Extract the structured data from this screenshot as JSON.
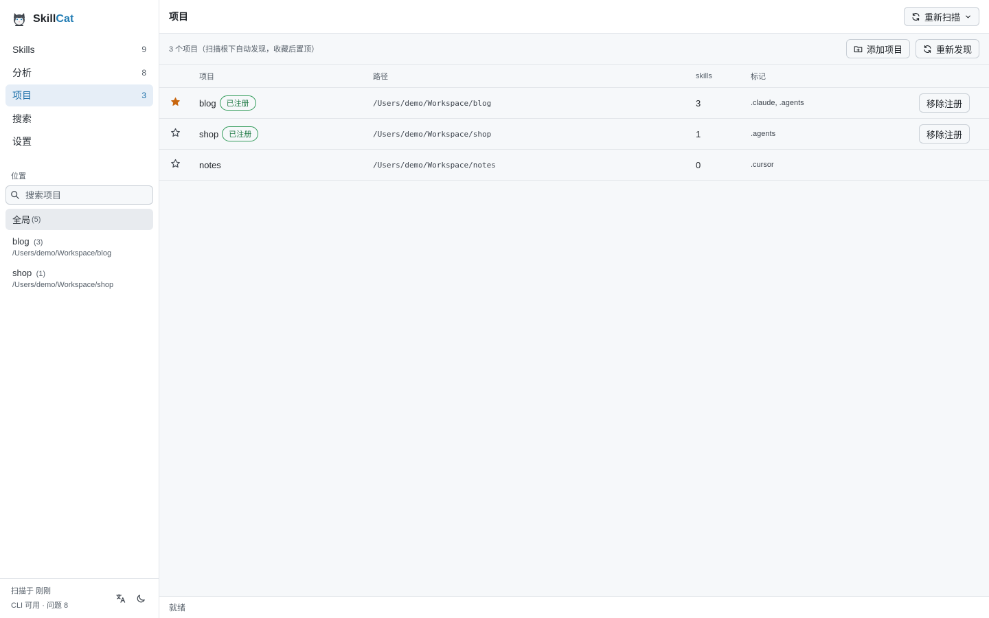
{
  "app": {
    "brand_part1": "Skill",
    "brand_part2": "Cat"
  },
  "nav": [
    {
      "label": "Skills",
      "count": "9"
    },
    {
      "label": "分析",
      "count": "8"
    },
    {
      "label": "项目",
      "count": "3"
    },
    {
      "label": "搜索",
      "count": ""
    },
    {
      "label": "设置",
      "count": ""
    }
  ],
  "locations": {
    "section_label": "位置",
    "search_placeholder": "搜索项目",
    "items": [
      {
        "name": "全局",
        "count": "(5)",
        "path": ""
      },
      {
        "name": "blog",
        "count": "(3)",
        "path": "/Users/demo/Workspace/blog"
      },
      {
        "name": "shop",
        "count": "(1)",
        "path": "/Users/demo/Workspace/shop"
      }
    ]
  },
  "footer": {
    "scan_label": "扫描于 刚刚",
    "status_label": "CLI 可用 · 问题 8"
  },
  "header": {
    "title": "项目",
    "rescan_label": "重新扫描"
  },
  "subbar": {
    "info": "3 个项目（扫描根下自动发现，收藏后置顶）",
    "add_label": "添加项目",
    "rediscover_label": "重新发现"
  },
  "table": {
    "columns": {
      "project": "项目",
      "path": "路径",
      "skills": "skills",
      "marks": "标记"
    },
    "rows": [
      {
        "starred": true,
        "name": "blog",
        "badge": "已注册",
        "path": "/Users/demo/Workspace/blog",
        "skills": "3",
        "marks": ".claude, .agents",
        "action": "移除注册"
      },
      {
        "starred": false,
        "name": "shop",
        "badge": "已注册",
        "path": "/Users/demo/Workspace/shop",
        "skills": "1",
        "marks": ".agents",
        "action": "移除注册"
      },
      {
        "starred": false,
        "name": "notes",
        "badge": "",
        "path": "/Users/demo/Workspace/notes",
        "skills": "0",
        "marks": ".cursor",
        "action": ""
      }
    ]
  },
  "statusbar": {
    "text": "就绪"
  },
  "colors": {
    "accent": "#1f7bb3",
    "active_bg": "#e6eef7",
    "star_filled": "#c8660f",
    "badge_green": "#2f9a57"
  },
  "icons": {
    "logo": "cat-logo-icon",
    "search": "search-icon",
    "translate": "translate-icon",
    "theme": "moon-icon",
    "refresh": "refresh-icon",
    "chevron": "chevron-down-icon",
    "add_folder": "folder-plus-icon",
    "star": "star-icon"
  }
}
